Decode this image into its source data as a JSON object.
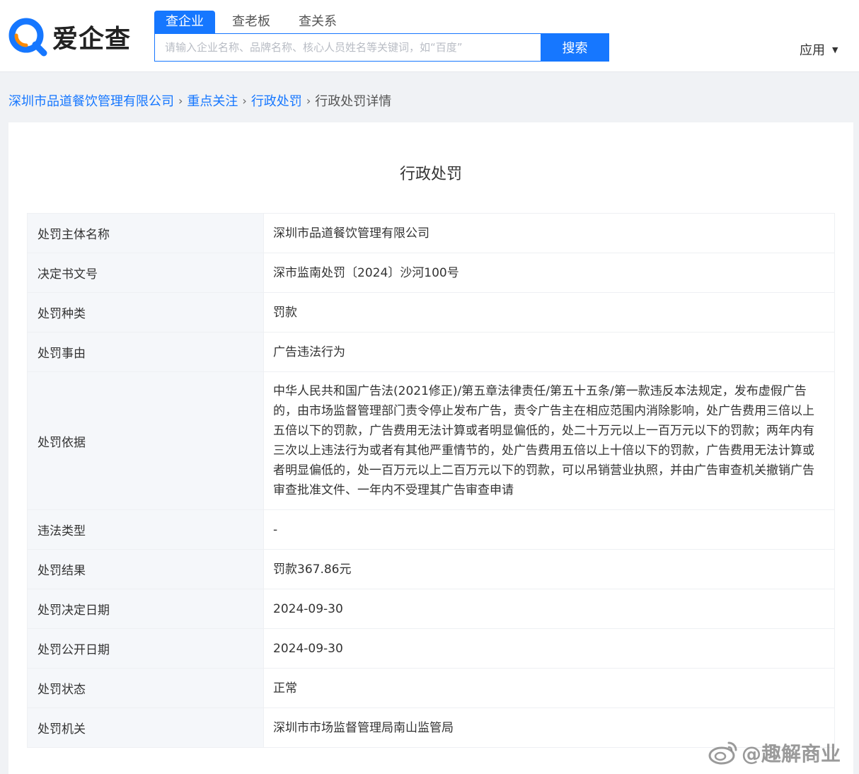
{
  "header": {
    "logo_text": "爱企查",
    "search_tabs": [
      {
        "label": "查企业",
        "active": true
      },
      {
        "label": "查老板",
        "active": false
      },
      {
        "label": "查关系",
        "active": false
      }
    ],
    "search_placeholder": "请输入企业名称、品牌名称、核心人员姓名等关键词，如“百度”",
    "search_button": "搜索",
    "app_menu": "应用"
  },
  "breadcrumb": {
    "items": [
      "深圳市品道餐饮管理有限公司",
      "重点关注",
      "行政处罚"
    ],
    "current": "行政处罚详情"
  },
  "card": {
    "title": "行政处罚",
    "rows": [
      {
        "label": "处罚主体名称",
        "value": "深圳市品道餐饮管理有限公司"
      },
      {
        "label": "决定书文号",
        "value": "深市监南处罚〔2024〕沙河100号"
      },
      {
        "label": "处罚种类",
        "value": "罚款"
      },
      {
        "label": "处罚事由",
        "value": "广告违法行为"
      },
      {
        "label": "处罚依据",
        "value": "中华人民共和国广告法(2021修正)/第五章法律责任/第五十五条/第一款违反本法规定，发布虚假广告的，由市场监督管理部门责令停止发布广告，责令广告主在相应范围内消除影响，处广告费用三倍以上五倍以下的罚款，广告费用无法计算或者明显偏低的，处二十万元以上一百万元以下的罚款；两年内有三次以上违法行为或者有其他严重情节的，处广告费用五倍以上十倍以下的罚款，广告费用无法计算或者明显偏低的，处一百万元以上二百万元以下的罚款，可以吊销营业执照，并由广告审查机关撤销广告审查批准文件、一年内不受理其广告审查申请"
      },
      {
        "label": "违法类型",
        "value": "-"
      },
      {
        "label": "处罚结果",
        "value": "罚款367.86元"
      },
      {
        "label": "处罚决定日期",
        "value": "2024-09-30"
      },
      {
        "label": "处罚公开日期",
        "value": "2024-09-30"
      },
      {
        "label": "处罚状态",
        "value": "正常"
      },
      {
        "label": "处罚机关",
        "value": "深圳市市场监督管理局南山监管局"
      }
    ]
  },
  "watermark": "@趣解商业",
  "colors": {
    "brand_blue": "#1677ff",
    "logo_orange": "#ff8a00",
    "label_bg": "#f5f7fa",
    "page_bg": "#f0f2f5"
  },
  "icons": {
    "logo": "search-magnifier-logo-icon",
    "app_caret": "caret-down-icon",
    "watermark": "weibo-icon"
  }
}
